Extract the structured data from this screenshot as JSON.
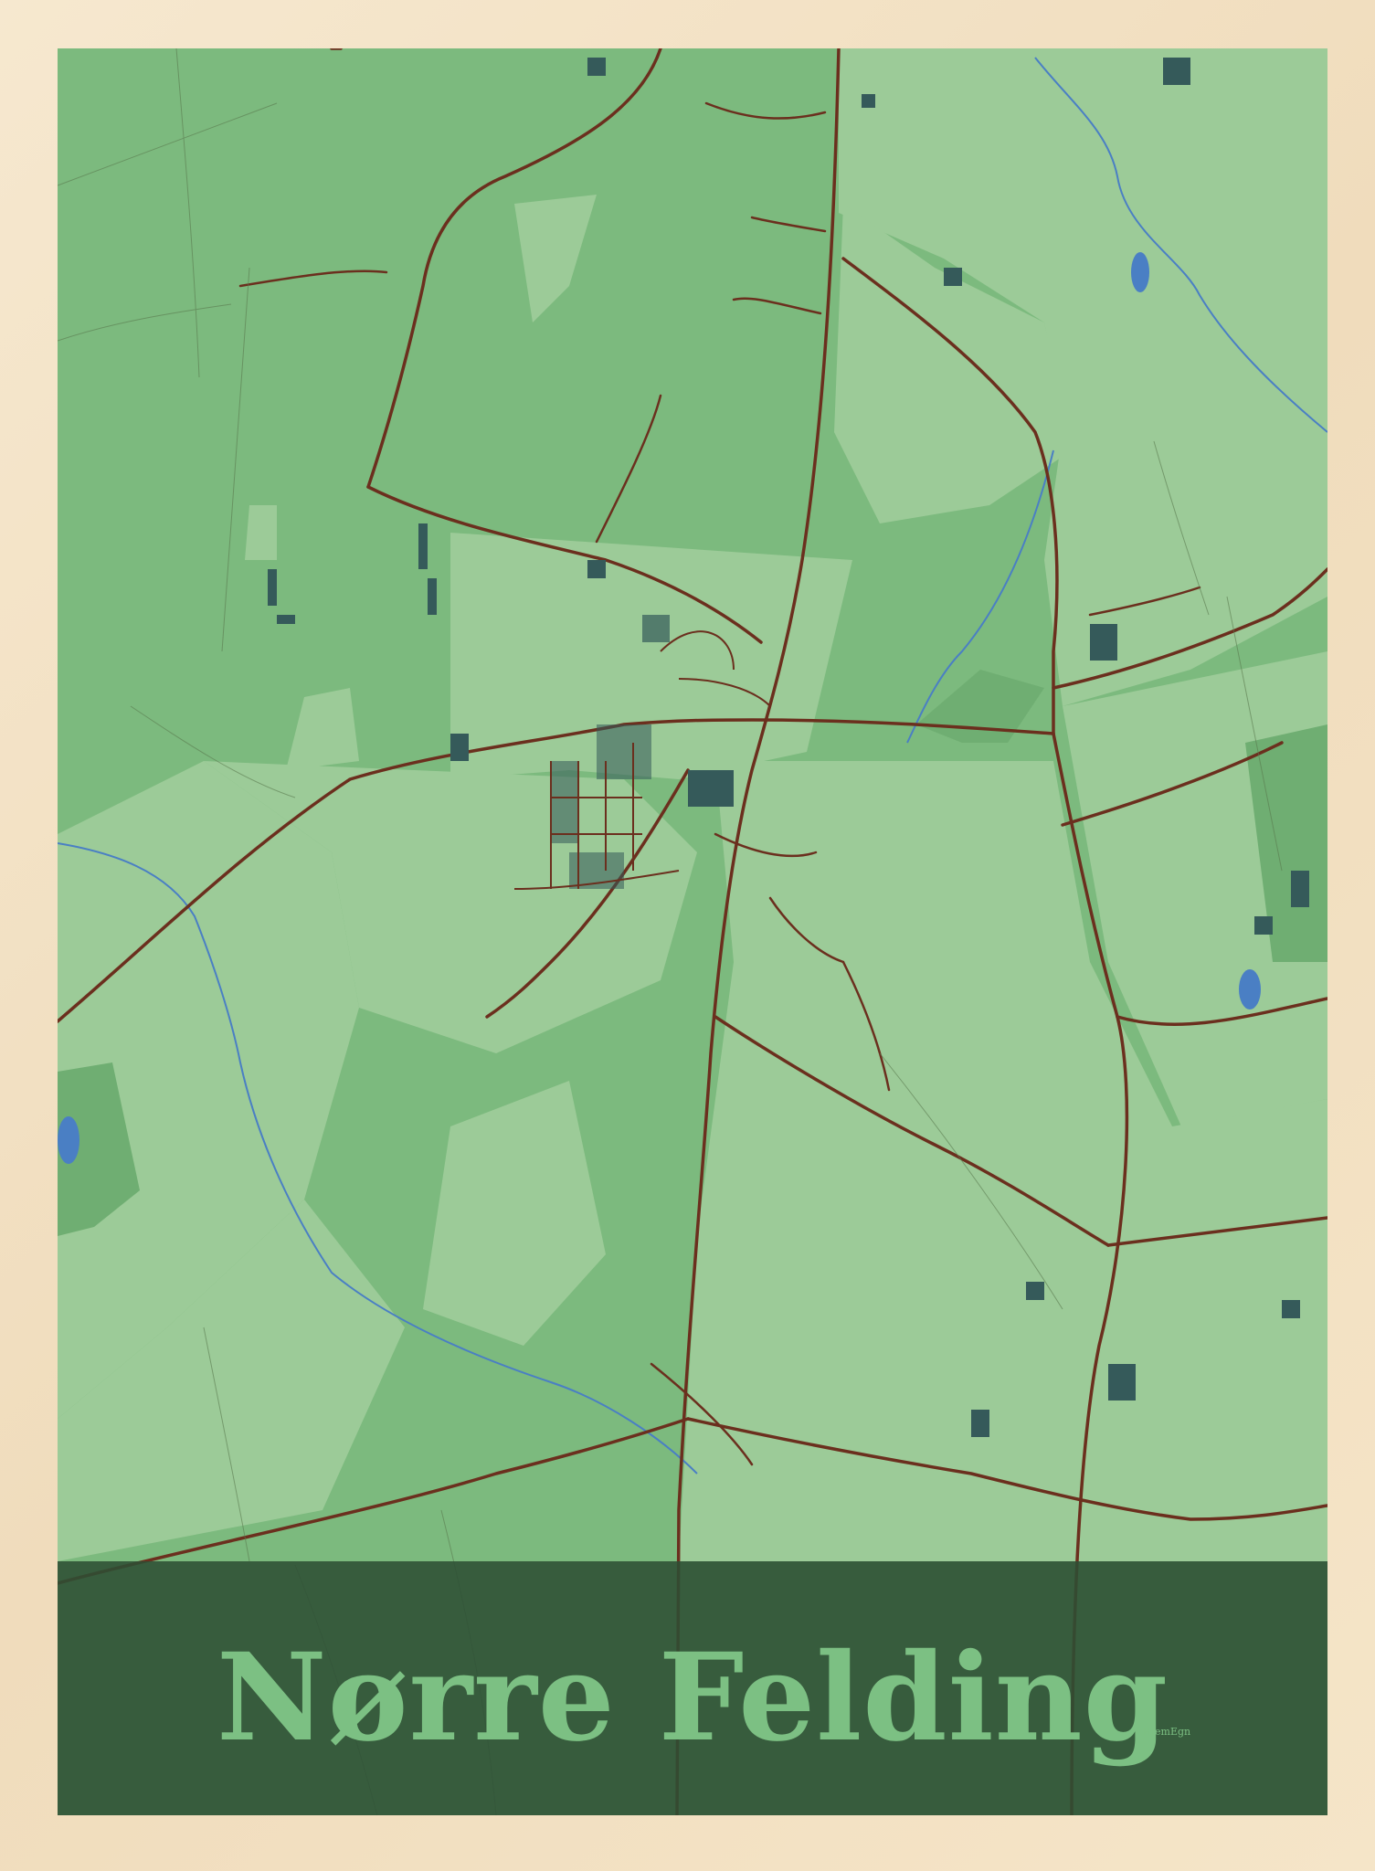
{
  "poster": {
    "title": "Nørre Felding",
    "brand": "HjemEgn"
  },
  "colors": {
    "frame": "#f3e2c6",
    "field_dark": "#7cba7e",
    "field_light": "#9ccb98",
    "road": "#6b2f1e",
    "water": "#4a7fc4",
    "building": "#355a5a",
    "banner": "#2e4e34",
    "title": "#7cc083"
  },
  "map": {
    "icons": [
      "lake-icon",
      "stream-icon",
      "road-icon",
      "building-icon"
    ]
  }
}
